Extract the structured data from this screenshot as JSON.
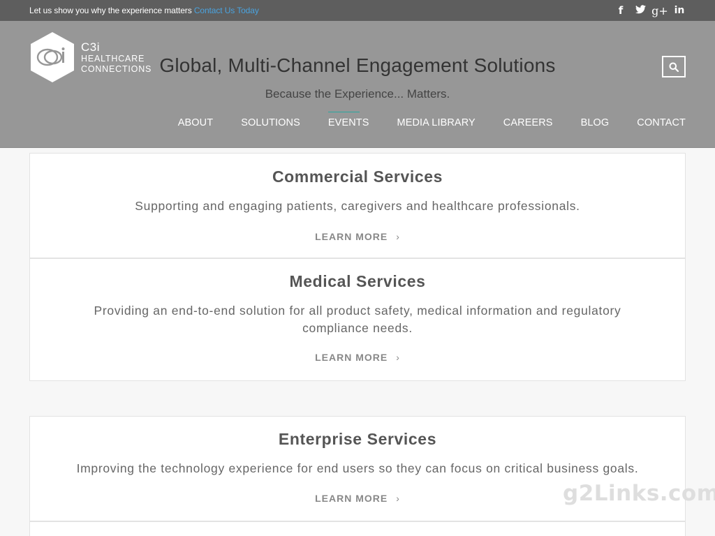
{
  "topbar": {
    "promo_text": "Let us show you why the experience matters",
    "promo_link": "Contact Us Today",
    "social": [
      {
        "icon": "facebook-icon",
        "glyph": "f"
      },
      {
        "icon": "twitter-icon",
        "glyph": "🐦"
      },
      {
        "icon": "google-plus-icon",
        "glyph": "g+"
      },
      {
        "icon": "linkedin-icon",
        "glyph": "in"
      }
    ]
  },
  "logo": {
    "line1": "C3i",
    "line2": "HEALTHCARE",
    "line3": "CONNECTIONS"
  },
  "header": {
    "headline": "Global, Multi-Channel Engagement Solutions",
    "tagline": "Because the Experience... Matters.",
    "search_icon": "search-icon"
  },
  "nav": [
    {
      "label": "ABOUT"
    },
    {
      "label": "SOLUTIONS"
    },
    {
      "label": "EVENTS"
    },
    {
      "label": "MEDIA LIBRARY"
    },
    {
      "label": "CAREERS"
    },
    {
      "label": "BLOG"
    },
    {
      "label": "CONTACT"
    }
  ],
  "services": [
    {
      "title": "Commercial Services",
      "description": "Supporting and engaging patients, caregivers and healthcare professionals.",
      "cta": "LEARN MORE"
    },
    {
      "title": "Medical Services",
      "description": "Providing an end-to-end solution for all product safety, medical information and regulatory compliance needs.",
      "cta": "LEARN MORE"
    },
    {
      "title": "Enterprise Services",
      "description": "Improving the technology experience for end users so they can focus on critical business goals.",
      "cta": "LEARN MORE"
    }
  ],
  "watermark": "g2Links.com",
  "colors": {
    "topbar": "#5e5e5e",
    "header": "#979797",
    "link": "#4aa3df",
    "active_indicator": "#2aa8a0"
  }
}
